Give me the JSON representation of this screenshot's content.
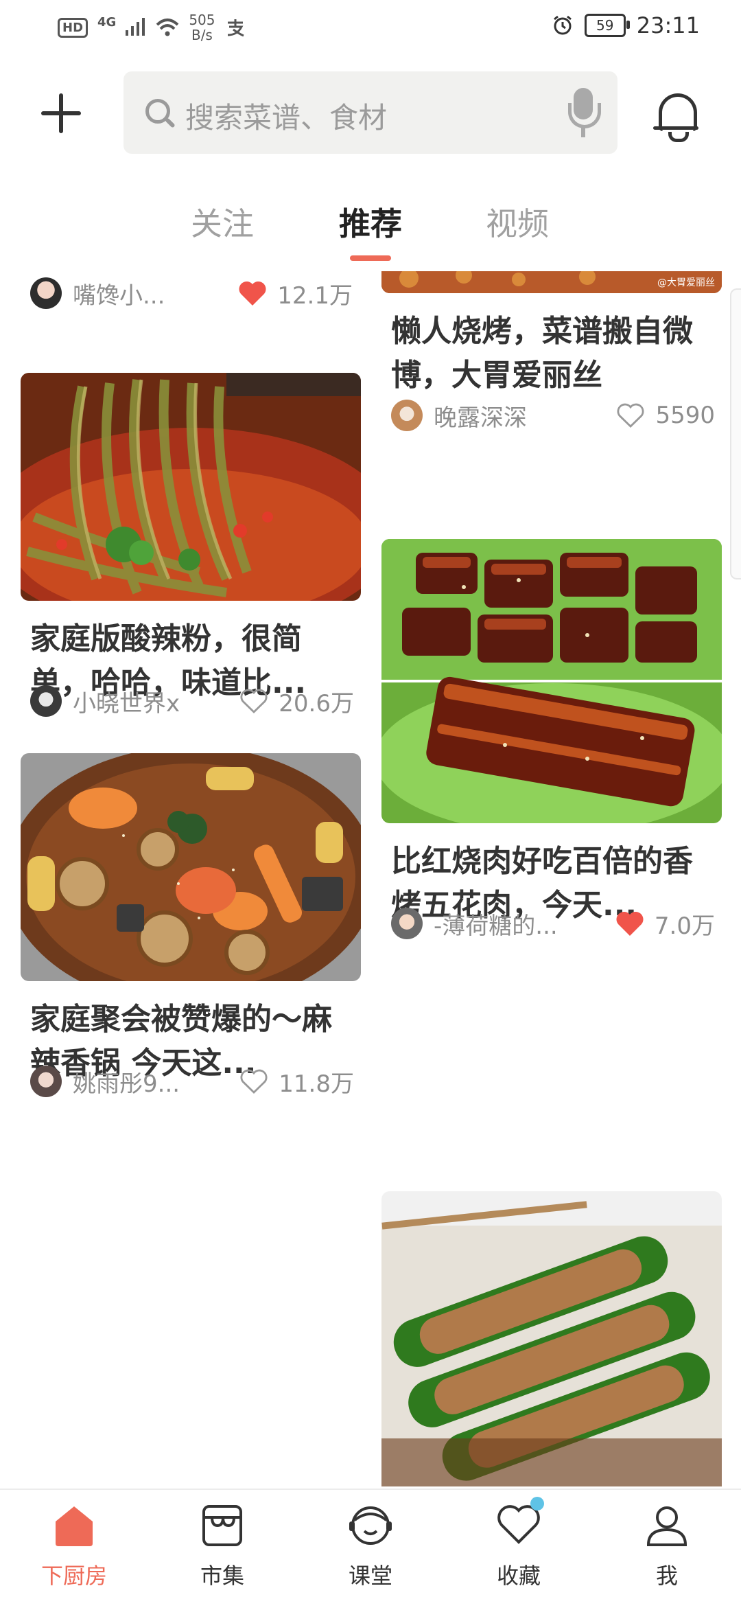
{
  "status_bar": {
    "hd": "HD",
    "network": "4G",
    "speed_value": "505",
    "speed_unit": "B/s",
    "battery": "59",
    "time": "23:11"
  },
  "search": {
    "placeholder": "搜索菜谱、食材"
  },
  "tabs": [
    {
      "label": "关注",
      "active": false
    },
    {
      "label": "推荐",
      "active": true
    },
    {
      "label": "视频",
      "active": false
    }
  ],
  "feed": {
    "left": [
      {
        "title": "",
        "author": "嘴馋小...",
        "likes": "12.1万",
        "liked": true
      },
      {
        "title": "家庭版酸辣粉，很简单，哈哈，味道比...",
        "author": "小晓世界x",
        "likes": "20.6万",
        "liked": false
      },
      {
        "title": "家庭聚会被赞爆的～麻辣香锅 今天这...",
        "author": "姚雨彤9...",
        "likes": "11.8万",
        "liked": false
      }
    ],
    "right": [
      {
        "title": "懒人烧烤，菜谱搬自微博，大胃爱丽丝",
        "author": "晚露深深",
        "likes": "5590",
        "liked": false,
        "watermark": "@大胃爱丽丝"
      },
      {
        "title": "比红烧肉好吃百倍的香烤五花肉，今天...",
        "author": "-薄荷糖的...",
        "likes": "7.0万",
        "liked": true
      },
      {
        "title": "",
        "author": "",
        "likes": "",
        "liked": false
      }
    ]
  },
  "bottom_nav": [
    {
      "label": "下厨房",
      "active": true
    },
    {
      "label": "市集",
      "active": false
    },
    {
      "label": "课堂",
      "active": false
    },
    {
      "label": "收藏",
      "active": false,
      "badge": true
    },
    {
      "label": "我",
      "active": false
    }
  ],
  "colors": {
    "accent": "#ee6a57",
    "liked_heart": "#f0544a",
    "badge": "#5fc3e6"
  }
}
